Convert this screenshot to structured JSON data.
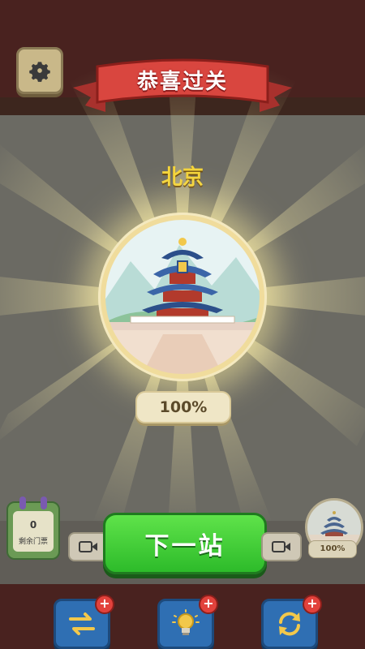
{
  "header": {
    "title": "恭喜过关"
  },
  "level": {
    "city": "北京",
    "progress_text": "100%"
  },
  "bottom": {
    "tickets_count": "0",
    "tickets_label": "剩余门票",
    "next_button": "下一站",
    "mini_progress_text": "100%"
  },
  "tools": {
    "badge": "+"
  },
  "icons": [
    "gear-icon",
    "video-icon",
    "swap-icon",
    "lightbulb-icon",
    "refresh-icon",
    "temple-of-heaven-image"
  ],
  "colors": {
    "accent_green": "#3fcf36",
    "ribbon_red": "#d9463f",
    "city_gold": "#f4d43a",
    "tool_blue": "#2f6fb3"
  }
}
